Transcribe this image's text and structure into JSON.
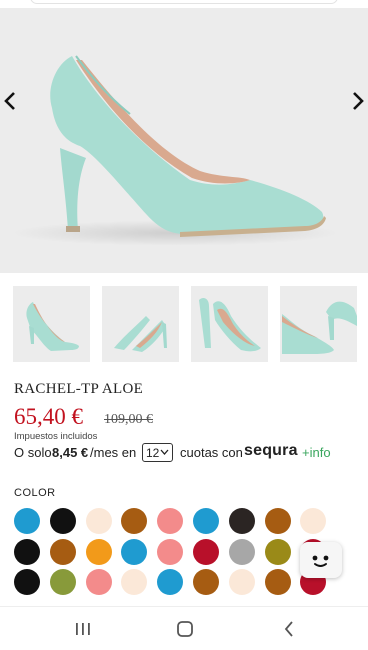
{
  "product": {
    "name": "RACHEL-TP ALOE",
    "price": "65,40 €",
    "old_price": "109,00 €",
    "tax_note": "Impuestos incluidos"
  },
  "financing": {
    "prefix": "O solo",
    "amount": "8,45 €",
    "per_month": "/mes en",
    "months": "12",
    "suffix": "cuotas con",
    "provider": "sequra",
    "info": "+info"
  },
  "color_section": {
    "title": "COLOR",
    "swatches": [
      [
        "#1f9bd0",
        "#111111",
        "#fbe8d8",
        "#a65c12",
        "#f38b8b",
        "#1f9bd0",
        "#2b2523",
        "#a65c12",
        "#fbe8d8"
      ],
      [
        "#111111",
        "#a65c12",
        "#f29a1a",
        "#1f9bd0",
        "#f38b8b",
        "#b8102a",
        "#a7a7a7",
        "#9a8a18",
        "#b8102a"
      ],
      [
        "#111111",
        "#889a3a",
        "#f38b8b",
        "#fbe8d8",
        "#1f9bd0",
        "#a65c12",
        "#fbe8d8",
        "#a65c12",
        "#b8102a"
      ]
    ]
  },
  "colors": {
    "accent_price": "#c2121f",
    "info_link": "#3aa65e",
    "shoe": "#a9ddd2"
  },
  "icons": {
    "prev": "chevron-left-icon",
    "next": "chevron-right-icon",
    "chat": "chatbot-face-icon",
    "recents": "recents-icon",
    "home": "home-icon",
    "back": "back-icon"
  }
}
